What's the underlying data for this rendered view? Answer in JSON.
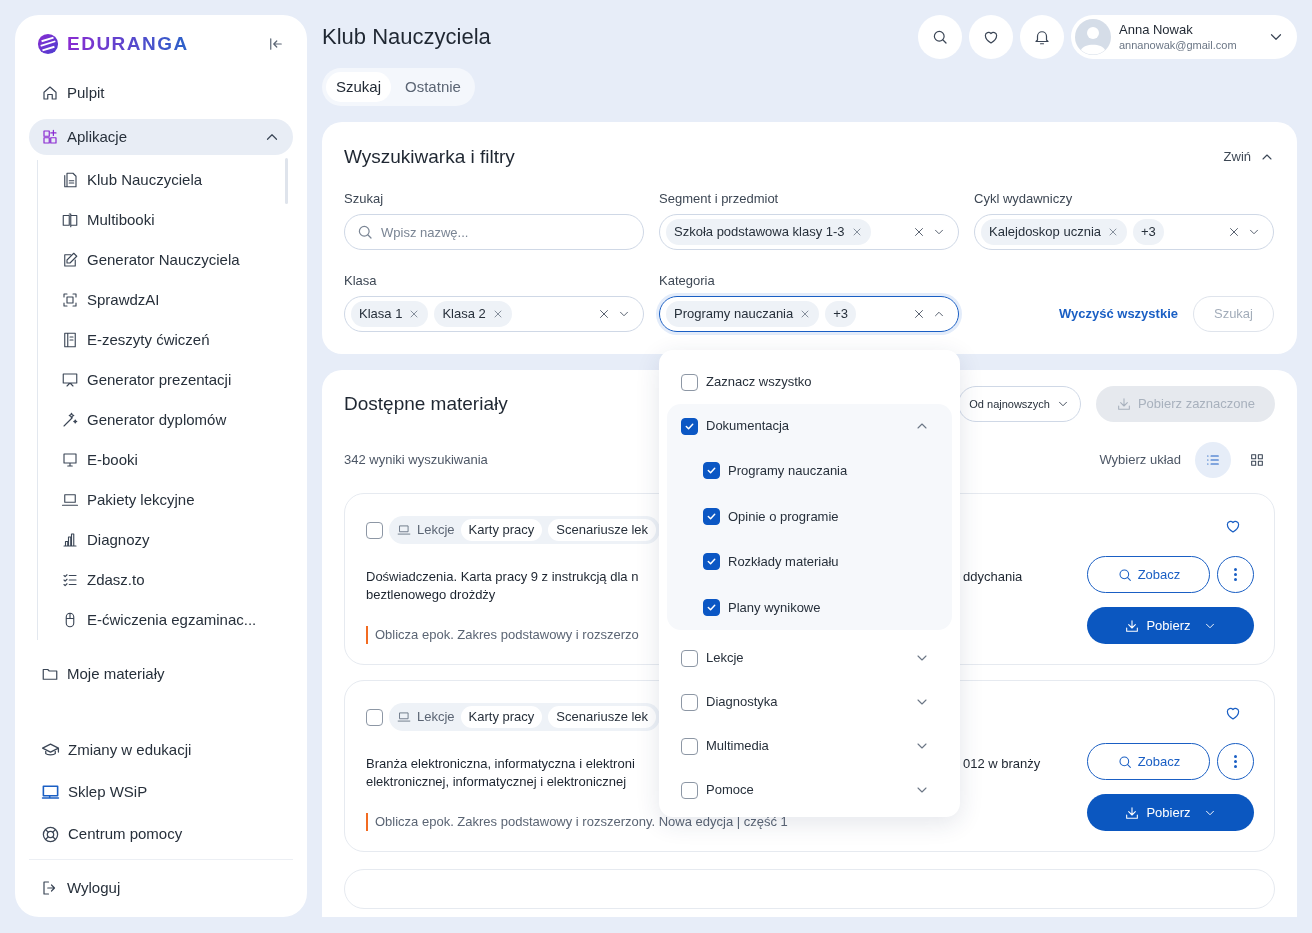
{
  "sidebar": {
    "logo": "EDURANGA",
    "items": [
      {
        "label": "Pulpit"
      },
      {
        "label": "Aplikacje",
        "expanded": true,
        "children": [
          {
            "label": "Klub Nauczyciela"
          },
          {
            "label": "Multibooki"
          },
          {
            "label": "Generator Nauczyciela"
          },
          {
            "label": "SprawdzAI"
          },
          {
            "label": "E-zeszyty ćwiczeń"
          },
          {
            "label": "Generator prezentacji"
          },
          {
            "label": "Generator dyplomów"
          },
          {
            "label": "E-booki"
          },
          {
            "label": "Pakiety lekcyjne"
          },
          {
            "label": "Diagnozy"
          },
          {
            "label": "Zdasz.to"
          },
          {
            "label": "E-ćwiczenia egzaminac..."
          }
        ]
      },
      {
        "label": "Moje materiały"
      }
    ],
    "bottom_items": [
      {
        "label": "Zmiany w edukacji"
      },
      {
        "label": "Sklep WSiP"
      },
      {
        "label": "Centrum pomocy"
      }
    ],
    "logout": "Wyloguj"
  },
  "header": {
    "title": "Klub Nauczyciela",
    "user": {
      "name": "Anna Nowak",
      "email": "annanowak@gmail.com"
    }
  },
  "tabs": [
    {
      "label": "Szukaj",
      "selected": true
    },
    {
      "label": "Ostatnie",
      "selected": false
    }
  ],
  "filters": {
    "title": "Wyszukiwarka i filtry",
    "collapse": "Zwiń",
    "fields": [
      {
        "kind": "search",
        "label": "Szukaj",
        "placeholder": "Wpisz nazwę..."
      },
      {
        "kind": "multiselect",
        "label": "Segment i przedmiot",
        "chips": [
          "Szkoła podstawowa klasy 1-3"
        ],
        "open": false
      },
      {
        "kind": "multiselect",
        "label": "Cykl wydawniczy",
        "chips": [
          "Kalejdoskop ucznia"
        ],
        "more": "+3",
        "open": false
      },
      {
        "kind": "multiselect",
        "label": "Klasa",
        "chips": [
          "Klasa 1",
          "Klasa 2"
        ],
        "open": false
      },
      {
        "kind": "multiselect",
        "label": "Kategoria",
        "chips": [
          "Programy nauczania"
        ],
        "more": "+3",
        "open": true
      }
    ],
    "clear": "Wyczyść wszystkie",
    "search_button": {
      "label": "Szukaj",
      "disabled": true
    }
  },
  "category_menu": [
    {
      "label": "Zaznacz wszystko",
      "checked": false
    },
    {
      "label": "Dokumentacja",
      "checked": true,
      "expanded": true,
      "children": [
        {
          "label": "Programy nauczania",
          "checked": true
        },
        {
          "label": "Opinie o programie",
          "checked": true
        },
        {
          "label": "Rozkłady materiału",
          "checked": true
        },
        {
          "label": "Plany wynikowe",
          "checked": true
        }
      ]
    },
    {
      "label": "Lekcje",
      "checked": false,
      "expanded": false
    },
    {
      "label": "Diagnostyka",
      "checked": false,
      "expanded": false
    },
    {
      "label": "Multimedia",
      "checked": false,
      "expanded": false
    },
    {
      "label": "Pomoce",
      "checked": false,
      "expanded": false
    }
  ],
  "materials": {
    "title": "Dostępne materiały",
    "sort": "Od najnowszych",
    "download_selected": {
      "label": "Pobierz zaznaczone",
      "disabled": true
    },
    "count": "342 wyniki wyszukiwania",
    "layout_label": "Wybierz układ",
    "layouts": [
      {
        "kind": "list",
        "selected": true
      },
      {
        "kind": "grid",
        "selected": false
      }
    ],
    "results": [
      {
        "checked": false,
        "tags": [
          {
            "kind": "category",
            "label": "Lekcje"
          },
          {
            "kind": "type",
            "label": "Karty pracy"
          },
          {
            "kind": "type",
            "label": "Scenariusze lek"
          }
        ],
        "title_lines": [
          "Doświadczenia. Karta pracy 9 z instrukcją dla n",
          "beztlenowego drożdży"
        ],
        "title_end": "ddychania",
        "subtitle": "Oblicza epok. Zakres podstawowy i rozszerzo",
        "favorite": false,
        "view": "Zobacz",
        "download": "Pobierz"
      },
      {
        "checked": false,
        "tags": [
          {
            "kind": "category",
            "label": "Lekcje"
          },
          {
            "kind": "type",
            "label": "Karty pracy"
          },
          {
            "kind": "type",
            "label": "Scenariusze lek"
          }
        ],
        "title_lines": [
          "Branża elektroniczna, informatyczna i elektroni",
          "elektronicznej, informatycznej i elektronicznej"
        ],
        "title_end": "012 w branży",
        "subtitle": "Oblicza epok. Zakres podstawowy i rozszerzony. Nowa edycja | część 1",
        "favorite": false,
        "view": "Zobacz",
        "download": "Pobierz"
      }
    ]
  }
}
